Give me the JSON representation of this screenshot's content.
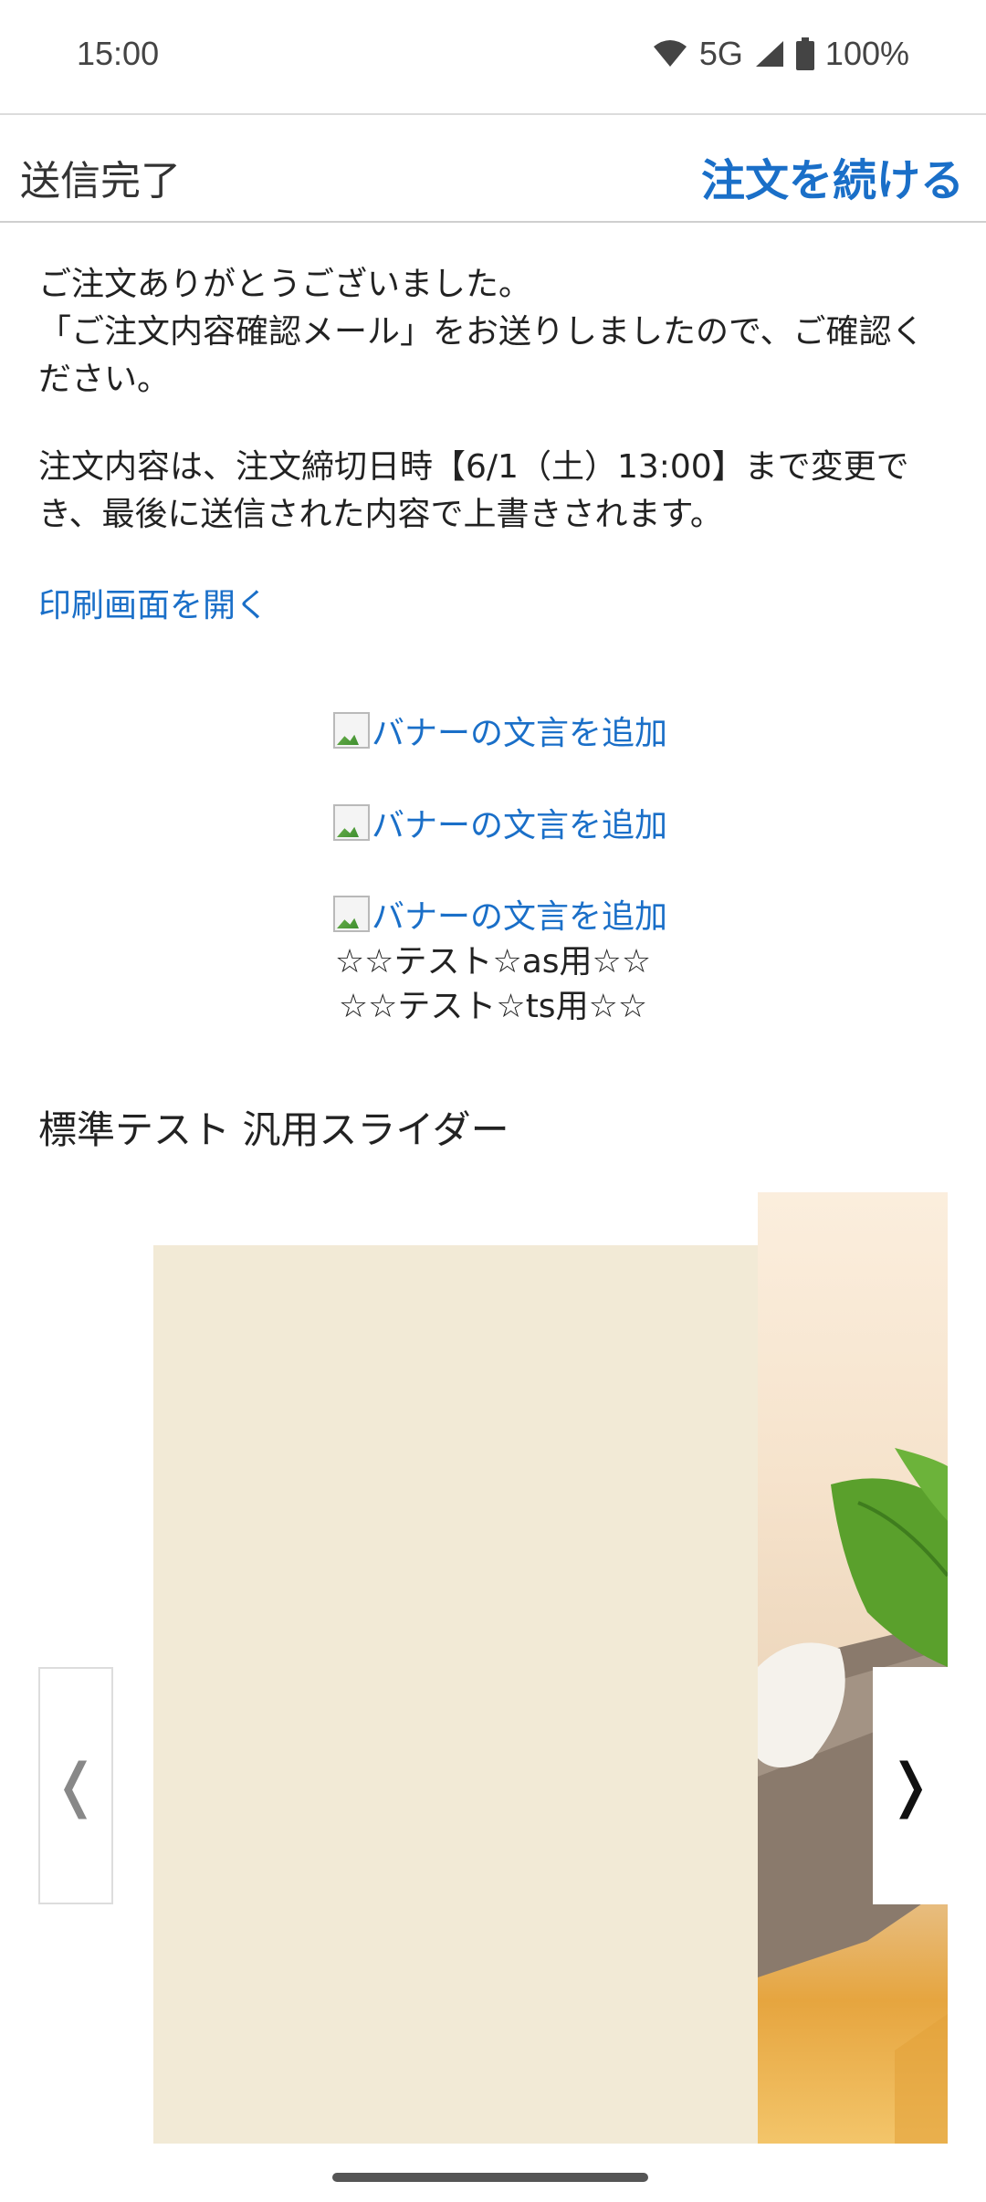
{
  "status_bar": {
    "time": "15:00",
    "network": "5G",
    "battery": "100%"
  },
  "header": {
    "title": "送信完了",
    "action": "注文を続ける"
  },
  "message": {
    "lines1": [
      "ご注文ありがとうございました。",
      "「ご注文内容確認メール」をお送りしましたので、ご確認く",
      "ださい。"
    ],
    "lines2": [
      "注文内容は、注文締切日時【6/1（土）13:00】まで変更で",
      "き、最後に送信された内容で上書きされます。"
    ],
    "print_link": "印刷画面を開く"
  },
  "banners": [
    {
      "alt": "バナーの文言を追加"
    },
    {
      "alt": "バナーの文言を追加"
    },
    {
      "alt": "バナーの文言を追加"
    }
  ],
  "test_lines": [
    "☆☆テスト☆as用☆☆",
    "☆☆テスト☆ts用☆☆"
  ],
  "slider": {
    "title": "標準テスト 汎用スライダー",
    "prev_glyph": "❬",
    "next_glyph": "❭"
  },
  "colors": {
    "accent": "#1a6fc8",
    "slide_bg": "#f2ead6"
  }
}
